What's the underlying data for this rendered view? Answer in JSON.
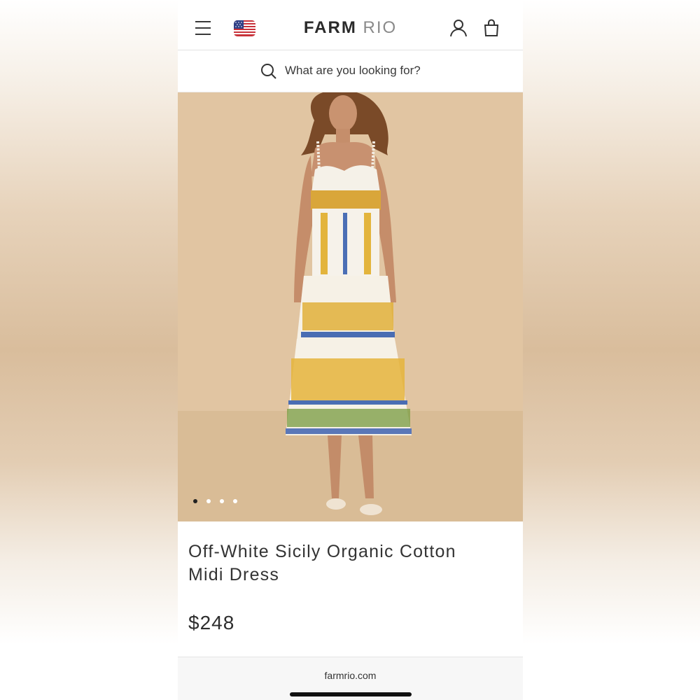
{
  "header": {
    "brand_bold": "FARM",
    "brand_light": "RIO",
    "menu_icon": "hamburger-menu-icon",
    "flag_icon": "us-flag-icon",
    "account_icon": "user-icon",
    "bag_icon": "shopping-bag-icon"
  },
  "search": {
    "placeholder": "What are you looking for?",
    "icon": "search-icon"
  },
  "gallery": {
    "slide_count": 4,
    "active_index": 0
  },
  "product": {
    "title_line1": "Off-White Sicily Organic Cotton",
    "title_line2": "Midi Dress",
    "price": "$248"
  },
  "browser": {
    "domain": "farmrio.com"
  },
  "colors": {
    "hero_background": "#e0c4a2",
    "text": "#333333"
  }
}
